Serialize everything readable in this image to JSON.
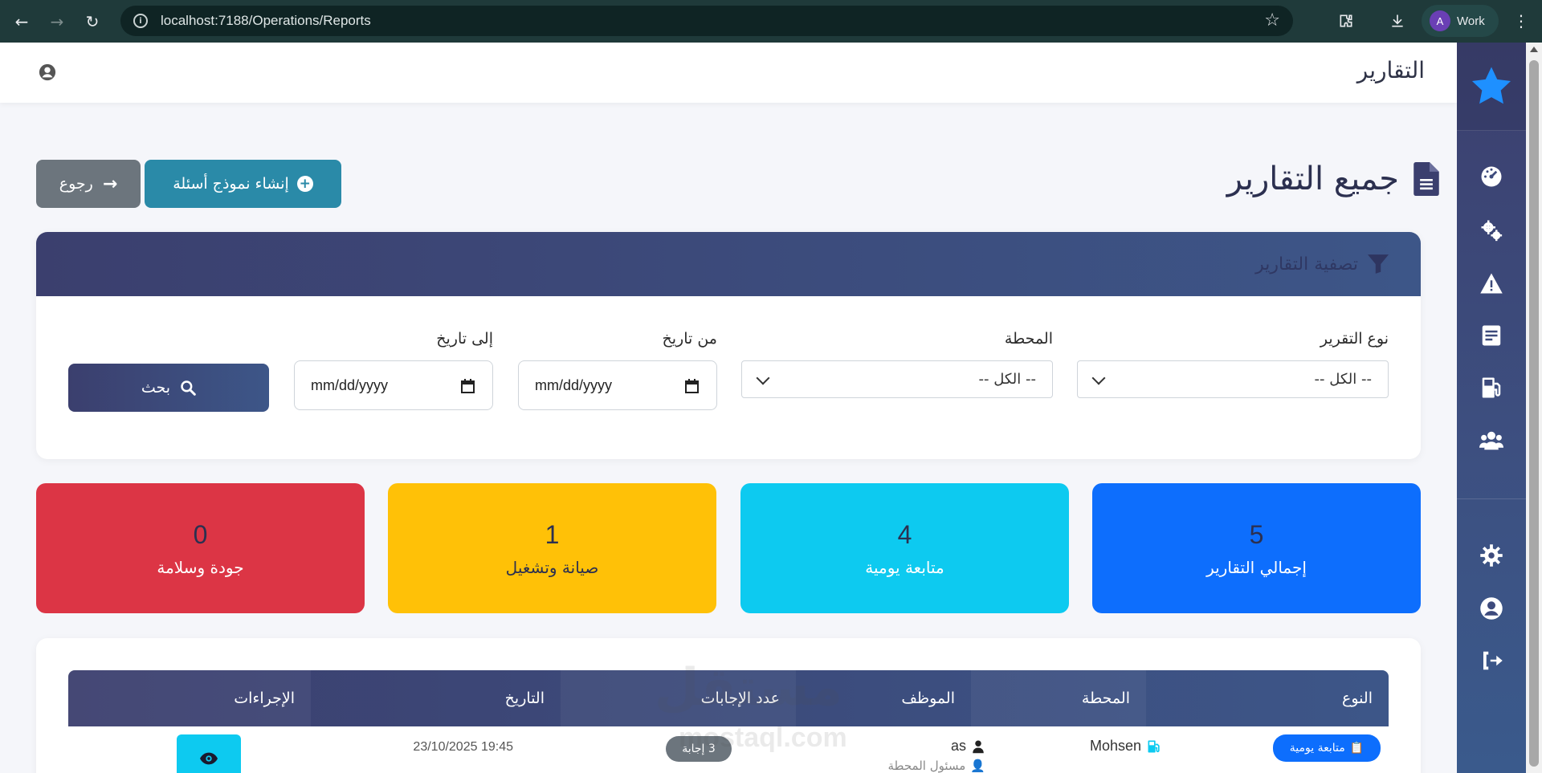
{
  "browser": {
    "url": "localhost:7188/Operations/Reports",
    "profile_initial": "A",
    "profile_label": "Work"
  },
  "topbar": {
    "title": "التقارير"
  },
  "page": {
    "heading": "جميع التقارير",
    "create_button": "إنشاء نموذج أسئلة",
    "back_button": "رجوع"
  },
  "filter": {
    "title": "تصفية التقارير",
    "report_type_label": "نوع التقرير",
    "report_type_value": "-- الكل --",
    "station_label": "المحطة",
    "station_value": "-- الكل --",
    "from_date_label": "من تاريخ",
    "from_date_value": "mm/dd/yyyy",
    "to_date_label": "إلى تاريخ",
    "to_date_value": "mm/dd/yyyy",
    "search_button": "بحث"
  },
  "stats": [
    {
      "value": "5",
      "label": "إجمالي التقارير",
      "color": "#0d6efd"
    },
    {
      "value": "4",
      "label": "متابعة يومية",
      "color": "#0dcaf0"
    },
    {
      "value": "1",
      "label": "صيانة وتشغيل",
      "color": "#ffc107"
    },
    {
      "value": "0",
      "label": "جودة وسلامة",
      "color": "#dc3545"
    }
  ],
  "table": {
    "headers": [
      "النوع",
      "المحطة",
      "الموظف",
      "عدد الإجابات",
      "التاريخ",
      "الإجراءات"
    ],
    "rows": [
      {
        "type": "متابعة يومية",
        "station": "Mohsen",
        "employee": "as",
        "employee_role": "مسئول المحطة",
        "answers": "3 إجابة",
        "date": "19:45 23/10/2025"
      }
    ]
  },
  "watermark": {
    "text": "مستقل",
    "domain": "mostaql.com"
  },
  "colors": {
    "sidebar": "#3b3f6e",
    "accent": "#2a8aa8",
    "brand_star": "#1e90ff"
  },
  "icons": {
    "sidebar": [
      "dashboard-icon",
      "gears-icon",
      "warning-icon",
      "report-icon",
      "fuel-icon",
      "users-icon",
      "settings-icon",
      "user-circle-icon",
      "logout-icon"
    ]
  }
}
